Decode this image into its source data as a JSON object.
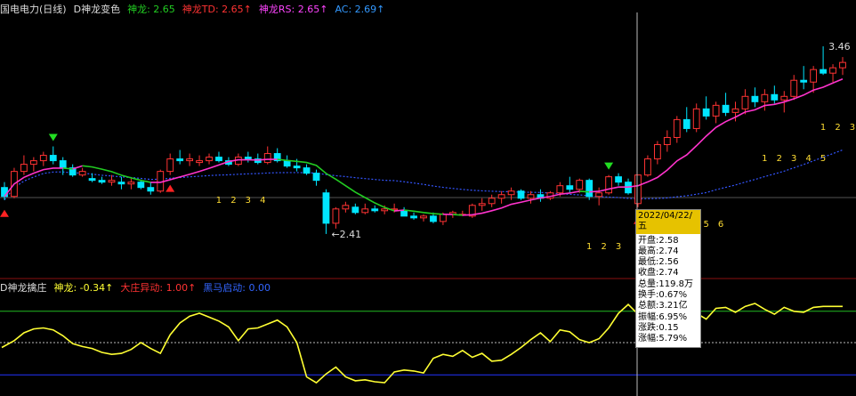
{
  "top_header": {
    "stock": "国电电力(日线)",
    "indicator": "D神龙变色",
    "items": [
      {
        "label": "神龙:",
        "value": "2.65",
        "color": "#22cc22"
      },
      {
        "label": "神龙TD:",
        "value": "2.65↑",
        "color": "#ff3333"
      },
      {
        "label": "神龙RS:",
        "value": "2.65↑",
        "color": "#ff44ff"
      },
      {
        "label": "AC:",
        "value": "2.69↑",
        "color": "#3399ff"
      }
    ]
  },
  "bottom_header": {
    "indicator": "D神龙擒庄",
    "items": [
      {
        "label": "神龙:",
        "value": "-0.34↑",
        "color": "#ffff33"
      },
      {
        "label": "大庄异动:",
        "value": "1.00↑",
        "color": "#ff3333"
      },
      {
        "label": "黑马启动:",
        "value": "0.00",
        "color": "#3366ff"
      }
    ]
  },
  "tooltip": {
    "date": "2022/04/22/五",
    "rows": [
      "开盘:2.58",
      "最高:2.74",
      "最低:2.56",
      "收盘:2.74",
      "总量:119.8万",
      "换手:0.67%",
      "总额:3.21亿",
      "振幅:6.95%",
      "涨跌:0.15",
      "涨幅:5.79%"
    ]
  },
  "colors": {
    "up": "#ff3333",
    "down": "#00e5ff",
    "ma": "#22cc22",
    "trend": "#ff33cc",
    "avg": "#3355ff",
    "osc": "#ffff33",
    "green_line": "#22bb22",
    "blue_line": "#2233ff"
  },
  "chart_data": [
    {
      "type": "candlestick",
      "ylim": [
        2.3,
        3.55
      ],
      "annotations": [
        {
          "text": "←2.41",
          "value": 2.41
        },
        {
          "text": "3.46",
          "value": 3.46
        }
      ],
      "count_labels": [
        [
          "1",
          "2",
          "3",
          "4"
        ],
        [
          "1",
          "2",
          "3"
        ],
        [
          "5",
          "6"
        ],
        [
          "1",
          "2",
          "3",
          "4",
          "5"
        ],
        [
          "1",
          "2",
          "3"
        ]
      ],
      "candles": [
        [
          2.67,
          2.7,
          2.6,
          2.62
        ],
        [
          2.62,
          2.78,
          2.61,
          2.76
        ],
        [
          2.76,
          2.85,
          2.74,
          2.8
        ],
        [
          2.8,
          2.84,
          2.76,
          2.82
        ],
        [
          2.82,
          2.87,
          2.79,
          2.85
        ],
        [
          2.85,
          2.9,
          2.8,
          2.82
        ],
        [
          2.82,
          2.84,
          2.74,
          2.78
        ],
        [
          2.78,
          2.8,
          2.73,
          2.74
        ],
        [
          2.74,
          2.78,
          2.73,
          2.76
        ],
        [
          2.72,
          2.75,
          2.7,
          2.71
        ],
        [
          2.71,
          2.73,
          2.69,
          2.7
        ],
        [
          2.7,
          2.74,
          2.68,
          2.71
        ],
        [
          2.7,
          2.73,
          2.66,
          2.69
        ],
        [
          2.69,
          2.72,
          2.66,
          2.7
        ],
        [
          2.7,
          2.71,
          2.66,
          2.67
        ],
        [
          2.67,
          2.7,
          2.63,
          2.65
        ],
        [
          2.65,
          2.77,
          2.64,
          2.76
        ],
        [
          2.76,
          2.86,
          2.74,
          2.83
        ],
        [
          2.83,
          2.88,
          2.8,
          2.82
        ],
        [
          2.82,
          2.86,
          2.79,
          2.83
        ],
        [
          2.81,
          2.85,
          2.79,
          2.82
        ],
        [
          2.82,
          2.86,
          2.8,
          2.84
        ],
        [
          2.84,
          2.87,
          2.81,
          2.82
        ],
        [
          2.82,
          2.84,
          2.79,
          2.8
        ],
        [
          2.8,
          2.86,
          2.79,
          2.84
        ],
        [
          2.84,
          2.87,
          2.81,
          2.83
        ],
        [
          2.83,
          2.86,
          2.8,
          2.81
        ],
        [
          2.81,
          2.9,
          2.8,
          2.86
        ],
        [
          2.86,
          2.89,
          2.81,
          2.82
        ],
        [
          2.82,
          2.85,
          2.78,
          2.79
        ],
        [
          2.79,
          2.83,
          2.76,
          2.78
        ],
        [
          2.78,
          2.8,
          2.74,
          2.75
        ],
        [
          2.75,
          2.77,
          2.68,
          2.71
        ],
        [
          2.64,
          2.66,
          2.41,
          2.47
        ],
        [
          2.47,
          2.56,
          2.44,
          2.55
        ],
        [
          2.55,
          2.59,
          2.53,
          2.57
        ],
        [
          2.56,
          2.58,
          2.52,
          2.53
        ],
        [
          2.53,
          2.58,
          2.52,
          2.55
        ],
        [
          2.55,
          2.57,
          2.53,
          2.54
        ],
        [
          2.54,
          2.57,
          2.52,
          2.55
        ],
        [
          2.55,
          2.58,
          2.53,
          2.55
        ],
        [
          2.54,
          2.56,
          2.51,
          2.51
        ],
        [
          2.51,
          2.53,
          2.49,
          2.5
        ],
        [
          2.5,
          2.52,
          2.48,
          2.51
        ],
        [
          2.51,
          2.53,
          2.47,
          2.48
        ],
        [
          2.48,
          2.53,
          2.46,
          2.52
        ],
        [
          2.52,
          2.54,
          2.5,
          2.53
        ],
        [
          2.52,
          2.54,
          2.51,
          2.52
        ],
        [
          2.51,
          2.58,
          2.5,
          2.57
        ],
        [
          2.57,
          2.61,
          2.54,
          2.58
        ],
        [
          2.58,
          2.63,
          2.56,
          2.61
        ],
        [
          2.61,
          2.65,
          2.58,
          2.63
        ],
        [
          2.63,
          2.67,
          2.6,
          2.65
        ],
        [
          2.65,
          2.66,
          2.6,
          2.61
        ],
        [
          2.61,
          2.65,
          2.58,
          2.63
        ],
        [
          2.63,
          2.66,
          2.59,
          2.61
        ],
        [
          2.61,
          2.65,
          2.6,
          2.64
        ],
        [
          2.64,
          2.7,
          2.62,
          2.68
        ],
        [
          2.68,
          2.73,
          2.64,
          2.66
        ],
        [
          2.66,
          2.72,
          2.64,
          2.71
        ],
        [
          2.71,
          2.72,
          2.6,
          2.62
        ],
        [
          2.62,
          2.67,
          2.57,
          2.64
        ],
        [
          2.64,
          2.74,
          2.63,
          2.73
        ],
        [
          2.73,
          2.75,
          2.68,
          2.7
        ],
        [
          2.7,
          2.72,
          2.63,
          2.64
        ],
        [
          2.58,
          2.74,
          2.56,
          2.74
        ],
        [
          2.74,
          2.85,
          2.73,
          2.83
        ],
        [
          2.83,
          2.93,
          2.8,
          2.91
        ],
        [
          2.91,
          2.99,
          2.87,
          2.95
        ],
        [
          2.95,
          3.07,
          2.92,
          3.05
        ],
        [
          3.05,
          3.12,
          2.98,
          3.0
        ],
        [
          3.0,
          3.14,
          2.98,
          3.11
        ],
        [
          3.11,
          3.18,
          3.05,
          3.07
        ],
        [
          3.07,
          3.15,
          3.03,
          3.13
        ],
        [
          3.13,
          3.2,
          3.07,
          3.09
        ],
        [
          3.09,
          3.15,
          3.04,
          3.11
        ],
        [
          3.11,
          3.22,
          3.08,
          3.18
        ],
        [
          3.18,
          3.23,
          3.12,
          3.15
        ],
        [
          3.15,
          3.22,
          3.1,
          3.19
        ],
        [
          3.19,
          3.24,
          3.14,
          3.16
        ],
        [
          3.16,
          3.21,
          3.09,
          3.18
        ],
        [
          3.18,
          3.3,
          3.16,
          3.27
        ],
        [
          3.27,
          3.35,
          3.22,
          3.26
        ],
        [
          3.26,
          3.35,
          3.2,
          3.33
        ],
        [
          3.33,
          3.46,
          3.3,
          3.31
        ],
        [
          3.31,
          3.36,
          3.26,
          3.34
        ],
        [
          3.34,
          3.4,
          3.3,
          3.37
        ]
      ]
    },
    {
      "type": "line",
      "ylim": [
        -3,
        7
      ],
      "reference_lines": [
        5.2,
        2.0,
        -1.3
      ],
      "values": [
        1.5,
        2.2,
        3.0,
        3.4,
        3.5,
        3.3,
        2.7,
        1.9,
        1.6,
        1.4,
        1.0,
        0.8,
        0.9,
        1.3,
        2.0,
        1.4,
        0.9,
        2.8,
        4.0,
        4.7,
        5.0,
        4.6,
        4.2,
        3.6,
        2.2,
        3.4,
        3.5,
        3.9,
        4.3,
        3.6,
        2.0,
        -1.5,
        -2.1,
        -1.2,
        -0.5,
        -1.5,
        -1.9,
        -1.8,
        -2.0,
        -2.1,
        -1.0,
        -0.8,
        -0.9,
        -1.1,
        0.4,
        0.8,
        0.6,
        1.2,
        0.5,
        0.9,
        0.1,
        0.2,
        0.8,
        1.5,
        2.3,
        3.0,
        2.1,
        3.3,
        3.1,
        2.3,
        2.0,
        2.4,
        3.5,
        5.0,
        5.9,
        4.9,
        5.6,
        6.0,
        5.7,
        6.1,
        6.1,
        5.0,
        4.4,
        5.5,
        5.6,
        5.1,
        5.7,
        6.0,
        5.4,
        4.9,
        5.6,
        5.2,
        5.1,
        5.6,
        5.7,
        5.7,
        5.7
      ]
    }
  ]
}
